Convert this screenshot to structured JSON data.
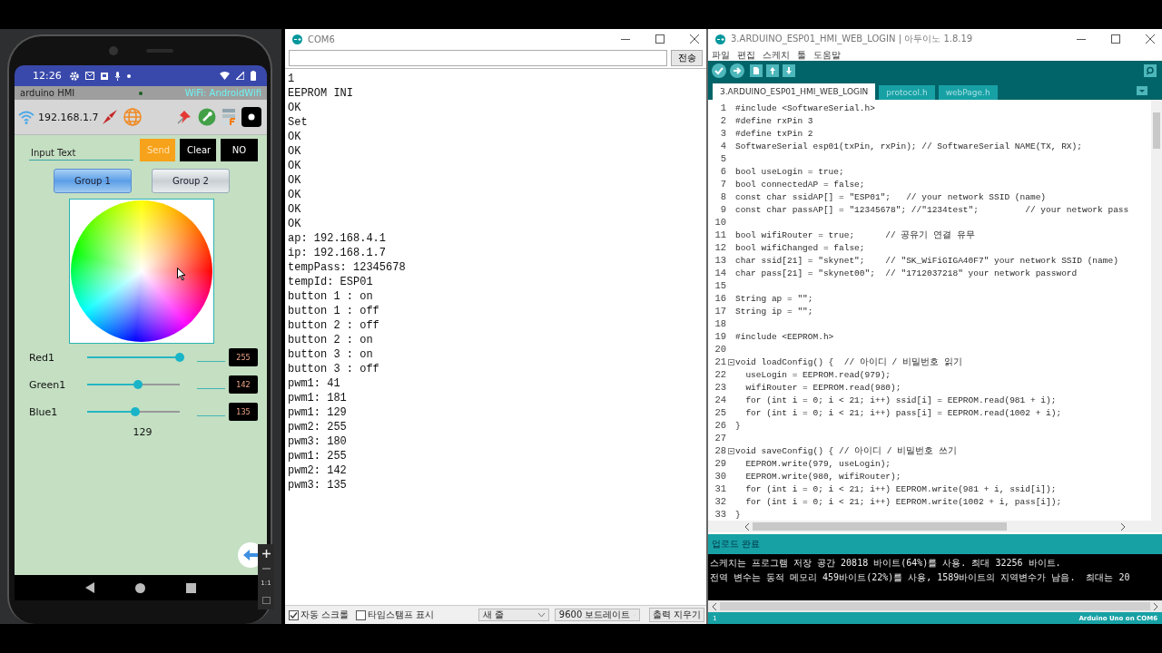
{
  "phone": {
    "status_bar": {
      "time": "12:26"
    },
    "app_bar": {
      "title": "arduino HMI",
      "wifi": "WiFi: AndroidWifi"
    },
    "toolbar": {
      "ip": "192.168.1.7"
    },
    "input": {
      "placeholder": "Input Text"
    },
    "buttons": [
      {
        "label": "Send",
        "color": "#f7a21b"
      },
      {
        "label": "Clear",
        "color": "#000000"
      },
      {
        "label": "NO",
        "color": "#000000"
      }
    ],
    "groups": [
      {
        "label": "Group 1",
        "selected": true
      },
      {
        "label": "Group 2",
        "selected": false
      }
    ],
    "sliders": [
      {
        "label": "Red1",
        "level": 1.0,
        "value": "255"
      },
      {
        "label": "Green1",
        "level": 0.55,
        "value": "142"
      },
      {
        "label": "Blue1",
        "level": 0.52,
        "value": "135"
      }
    ],
    "reading": "129",
    "zoom_panel": {
      "ratio": "1:1"
    }
  },
  "serial_monitor": {
    "title": "COM6",
    "send_button": "전송",
    "lines": [
      "1",
      "EEPROM INI",
      "OK",
      "Set",
      "OK",
      "OK",
      "OK",
      "OK",
      "OK",
      "OK",
      "OK",
      "ap: 192.168.4.1",
      "ip: 192.168.1.7",
      "tempPass: 12345678",
      "tempId: ESP01",
      "button 1 : on",
      "button 1 : off",
      "button 2 : off",
      "button 2 : on",
      "button 3 : on",
      "button 3 : off",
      "pwm1: 41",
      "pwm1: 181",
      "pwm1: 129",
      "pwm2: 255",
      "pwm3: 180",
      "pwm1: 255",
      "pwm2: 142",
      "pwm3: 135"
    ],
    "checkboxes": [
      {
        "label": "자동 스크롤",
        "checked": true
      },
      {
        "label": "타임스탬프 표시",
        "checked": false
      }
    ],
    "line_ending": "새 줄",
    "baud_rate": "9600 보드레이트",
    "clear_button": "출력 지우기"
  },
  "ide": {
    "title": "3.ARDUINO_ESP01_HMI_WEB_LOGIN | 아두이노 1.8.19",
    "menu": [
      "파일",
      "편집",
      "스케치",
      "툴",
      "도움말"
    ],
    "tabs": [
      {
        "label": "3.ARDUINO_ESP01_HMI_WEB_LOGIN",
        "selected": true
      },
      {
        "label": "protocol.h",
        "selected": false
      },
      {
        "label": "webPage.h",
        "selected": false
      }
    ],
    "code": [
      {
        "num": "1",
        "text": "#include <SoftwareSerial.h>"
      },
      {
        "num": "2",
        "text": "#define rxPin 3"
      },
      {
        "num": "3",
        "text": "#define txPin 2"
      },
      {
        "num": "4",
        "text": "SoftwareSerial esp01(txPin, rxPin); // SoftwareSerial NAME(TX, RX);"
      },
      {
        "num": "5"
      },
      {
        "num": "6",
        "text": "bool useLogin = true;"
      },
      {
        "num": "7",
        "text": "bool connectedAP = false;"
      },
      {
        "num": "8",
        "text": "const char ssidAP[] = \"ESP01\";   // your network SSID (name)"
      },
      {
        "num": "9",
        "text": "const char passAP[] = \"12345678\"; //\"1234test\";         // your network pass"
      },
      {
        "num": "10"
      },
      {
        "num": "11",
        "text": "bool wifiRouter = true;      // 공유기 연결 유무"
      },
      {
        "num": "12",
        "text": "bool wifiChanged = false;"
      },
      {
        "num": "13",
        "text": "char ssid[21] = \"skynet\";    // \"SK_WiFiGIGA40F7\" your network SSID (name)"
      },
      {
        "num": "14",
        "text": "char pass[21] = \"skynet00\";  // \"1712037218\" your network password"
      },
      {
        "num": "15"
      },
      {
        "num": "16",
        "text": "String ap = \"\";"
      },
      {
        "num": "17",
        "text": "String ip = \"\";"
      },
      {
        "num": "18"
      },
      {
        "num": "19",
        "text": "#include <EEPROM.h>"
      },
      {
        "num": "20"
      },
      {
        "num": "21",
        "text": "void loadConfig() {  // 아이디 / 비밀번호 읽기",
        "fold": true
      },
      {
        "num": "22",
        "text": "  useLogin = EEPROM.read(979);"
      },
      {
        "num": "23",
        "text": "  wifiRouter = EEPROM.read(980);"
      },
      {
        "num": "24",
        "text": "  for (int i = 0; i < 21; i++) ssid[i] = EEPROM.read(981 + i);"
      },
      {
        "num": "25",
        "text": "  for (int i = 0; i < 21; i++) pass[i] = EEPROM.read(1002 + i);"
      },
      {
        "num": "26",
        "text": "}"
      },
      {
        "num": "27"
      },
      {
        "num": "28",
        "text": "void saveConfig() { // 아이디 / 비밀번호 쓰기",
        "fold": true
      },
      {
        "num": "29",
        "text": "  EEPROM.write(979, useLogin);"
      },
      {
        "num": "30",
        "text": "  EEPROM.write(980, wifiRouter);"
      },
      {
        "num": "31",
        "text": "  for (int i = 0; i < 21; i++) EEPROM.write(981 + i, ssid[i]);"
      },
      {
        "num": "32",
        "text": "  for (int i = 0; i < 21; i++) EEPROM.write(1002 + i, pass[i]);"
      },
      {
        "num": "33",
        "text": "}"
      }
    ],
    "status": "업로드 완료",
    "console": [
      "스케치는 프로그램 저장 공간 20818 바이트(64%)를 사용. 최대 32256 바이트.",
      "전역 변수는 동적 메모리 459바이트(22%)를 사용, 1589바이트의 지역변수가 남음.  최대는 20"
    ],
    "line": "1",
    "board": "Arduino Uno on COM6"
  }
}
